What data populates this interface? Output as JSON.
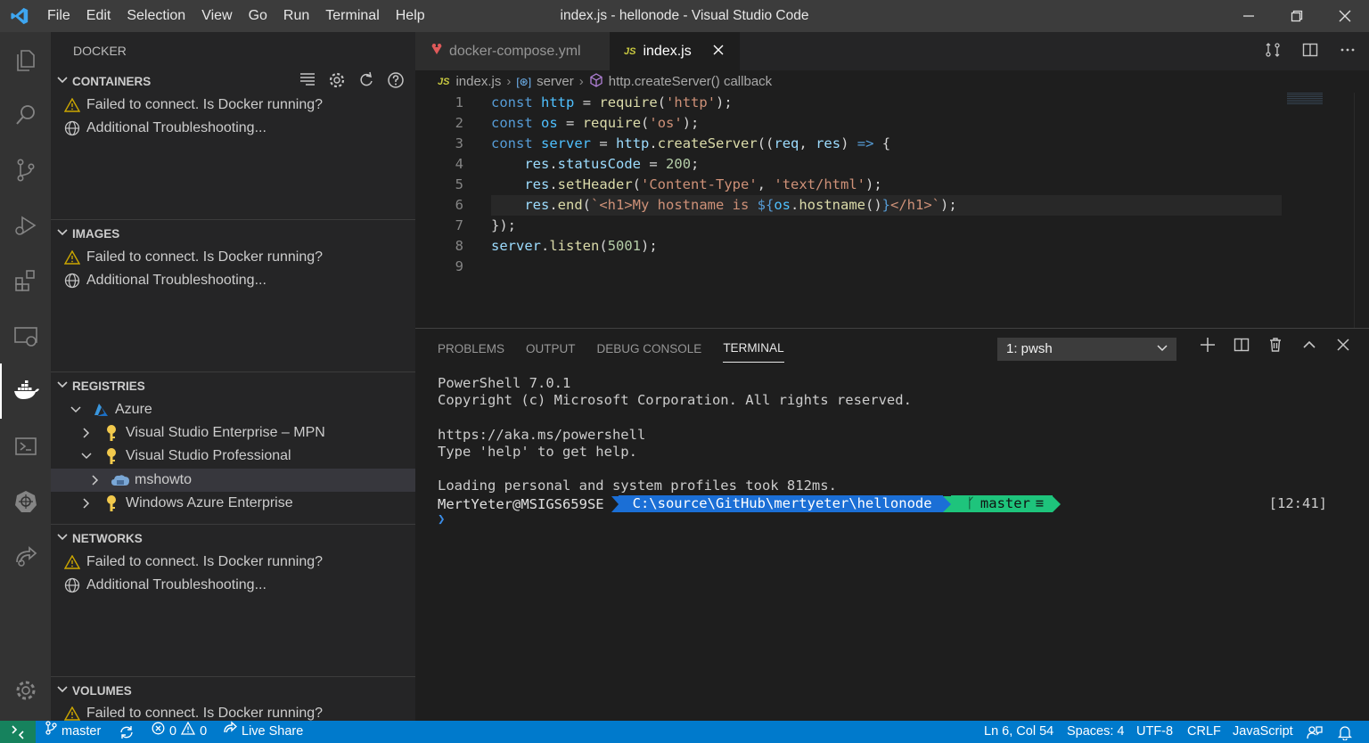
{
  "titlebar": {
    "menu": [
      "File",
      "Edit",
      "Selection",
      "View",
      "Go",
      "Run",
      "Terminal",
      "Help"
    ],
    "title": "index.js - hellonode - Visual Studio Code"
  },
  "sidebar": {
    "title": "DOCKER",
    "sections": {
      "containers": {
        "label": "CONTAINERS",
        "items": [
          "Failed to connect. Is Docker running?",
          "Additional Troubleshooting..."
        ]
      },
      "images": {
        "label": "IMAGES",
        "items": [
          "Failed to connect. Is Docker running?",
          "Additional Troubleshooting..."
        ]
      },
      "registries": {
        "label": "REGISTRIES",
        "azure": "Azure",
        "subscriptions": [
          "Visual Studio Enterprise – MPN",
          "Visual Studio Professional",
          "mshowto",
          "Windows Azure Enterprise"
        ]
      },
      "networks": {
        "label": "NETWORKS",
        "items": [
          "Failed to connect. Is Docker running?",
          "Additional Troubleshooting..."
        ]
      },
      "volumes": {
        "label": "VOLUMES",
        "items": [
          "Failed to connect. Is Docker running?"
        ]
      }
    }
  },
  "editor": {
    "tabs": [
      {
        "label": "docker-compose.yml",
        "active": false
      },
      {
        "label": "index.js",
        "active": true,
        "icon": "JS"
      }
    ],
    "breadcrumb": {
      "file": "index.js",
      "symbol1": "server",
      "symbol2": "http.createServer() callback"
    },
    "line_numbers": [
      "1",
      "2",
      "3",
      "4",
      "5",
      "6",
      "7",
      "8",
      "9"
    ]
  },
  "panel": {
    "tabs": [
      "PROBLEMS",
      "OUTPUT",
      "DEBUG CONSOLE",
      "TERMINAL"
    ],
    "active_tab": "TERMINAL",
    "terminal_select": "1: pwsh",
    "terminal_lines": [
      "PowerShell 7.0.1",
      "Copyright (c) Microsoft Corporation. All rights reserved.",
      "",
      "https://aka.ms/powershell",
      "Type 'help' to get help.",
      "",
      "Loading personal and system profiles took 812ms."
    ],
    "prompt_user": "MertYeter@MSIGS659SE",
    "prompt_path": "C:\\source\\GitHub\\mertyeter\\hellonode",
    "prompt_branch": "master",
    "prompt_branch_glyph": "≡",
    "prompt_caret": "❯",
    "clock": "[12:41]"
  },
  "statusbar": {
    "branch": "master",
    "errors": "0",
    "warnings": "0",
    "live_share": "Live Share",
    "position": "Ln 6, Col 54",
    "spaces": "Spaces: 4",
    "encoding": "UTF-8",
    "eol": "CRLF",
    "language": "JavaScript"
  },
  "colors": {
    "accent": "#007acc",
    "remote": "#16825d",
    "path_segment": "#1b6fd6",
    "git_segment": "#1ec47c",
    "warning": "#cca700"
  }
}
